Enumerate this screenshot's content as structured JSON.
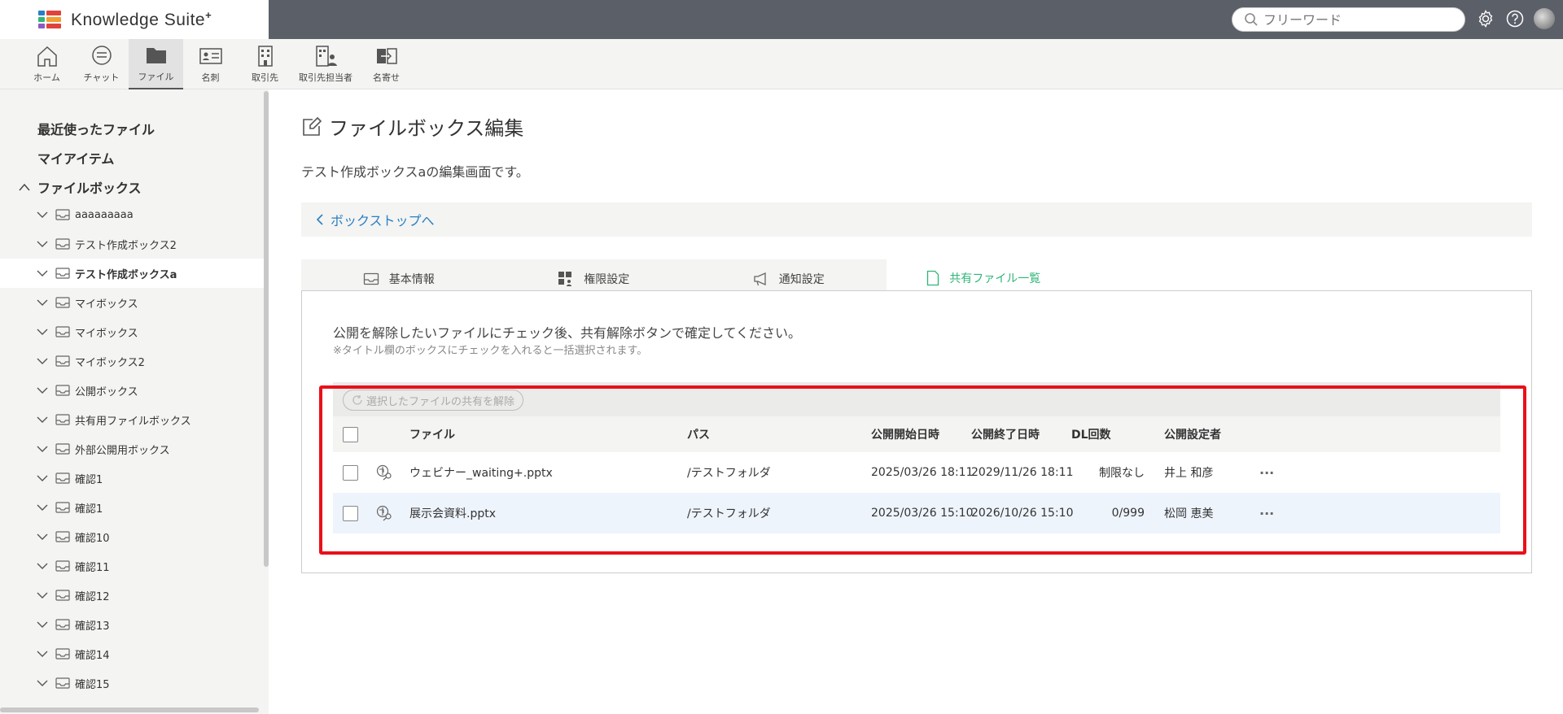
{
  "brand": {
    "name": "Knowledge Suite",
    "mark": "+",
    "colors": [
      "#2a7fc2",
      "#e0433b",
      "#2fb578",
      "#f0a030",
      "#8a5cc2",
      "#e0433b"
    ]
  },
  "search": {
    "placeholder": "フリーワード"
  },
  "header_icons": [
    "gear-icon",
    "help-icon",
    "avatar"
  ],
  "appnav": [
    {
      "label": "ホーム",
      "icon": "home-icon"
    },
    {
      "label": "チャット",
      "icon": "chat-icon"
    },
    {
      "label": "ファイル",
      "icon": "folder-icon",
      "active": true
    },
    {
      "label": "名刺",
      "icon": "business-card-icon"
    },
    {
      "label": "取引先",
      "icon": "building-icon"
    },
    {
      "label": "取引先担当者",
      "icon": "contact-building-icon"
    },
    {
      "label": "名寄せ",
      "icon": "merge-icon"
    }
  ],
  "sidebar": {
    "recent": "最近使ったファイル",
    "my_items": "マイアイテム",
    "filebox": "ファイルボックス",
    "items": [
      "aaaaaaaaa",
      "テスト作成ボックス2",
      "テスト作成ボックスa",
      "マイボックス",
      "マイボックス",
      "マイボックス2",
      "公開ボックス",
      "共有用ファイルボックス",
      "外部公開用ボックス",
      "確認1",
      "確認1",
      "確認10",
      "確認11",
      "確認12",
      "確認13",
      "確認14",
      "確認15"
    ],
    "active_index": 2
  },
  "page": {
    "title": "ファイルボックス編集",
    "description": "テスト作成ボックスaの編集画面です。",
    "back_label": "ボックストップへ"
  },
  "tabs": [
    {
      "label": "基本情報",
      "icon": "inbox-icon"
    },
    {
      "label": "権限設定",
      "icon": "permission-icon"
    },
    {
      "label": "通知設定",
      "icon": "megaphone-icon"
    },
    {
      "label": "共有ファイル一覧",
      "icon": "file-icon",
      "active": true
    }
  ],
  "panel": {
    "message": "公開を解除したいファイルにチェック後、共有解除ボタンで確定してください。",
    "note": "※タイトル欄のボックスにチェックを入れると一括選択されます。",
    "unshare_button": "選択したファイルの共有を解除"
  },
  "table": {
    "headers": {
      "file": "ファイル",
      "path": "パス",
      "start": "公開開始日時",
      "end": "公開終了日時",
      "dl": "DL回数",
      "setter": "公開設定者"
    },
    "rows": [
      {
        "file": "ウェビナー_waiting+.pptx",
        "path": "/テストフォルダ",
        "start": "2025/03/26 18:11",
        "end": "2029/11/26 18:11",
        "dl": "制限なし",
        "setter": "井上 和彦",
        "more": "···"
      },
      {
        "file": "展示会資料.pptx",
        "path": "/テストフォルダ",
        "start": "2025/03/26 15:10",
        "end": "2026/10/26 15:10",
        "dl": "0/999",
        "setter": "松岡 恵美",
        "more": "···"
      }
    ]
  },
  "colors": {
    "accent_green": "#2fb578",
    "link_blue": "#2a7fc2",
    "highlight_red": "#e8101a",
    "topbar": "#5b5f68"
  }
}
